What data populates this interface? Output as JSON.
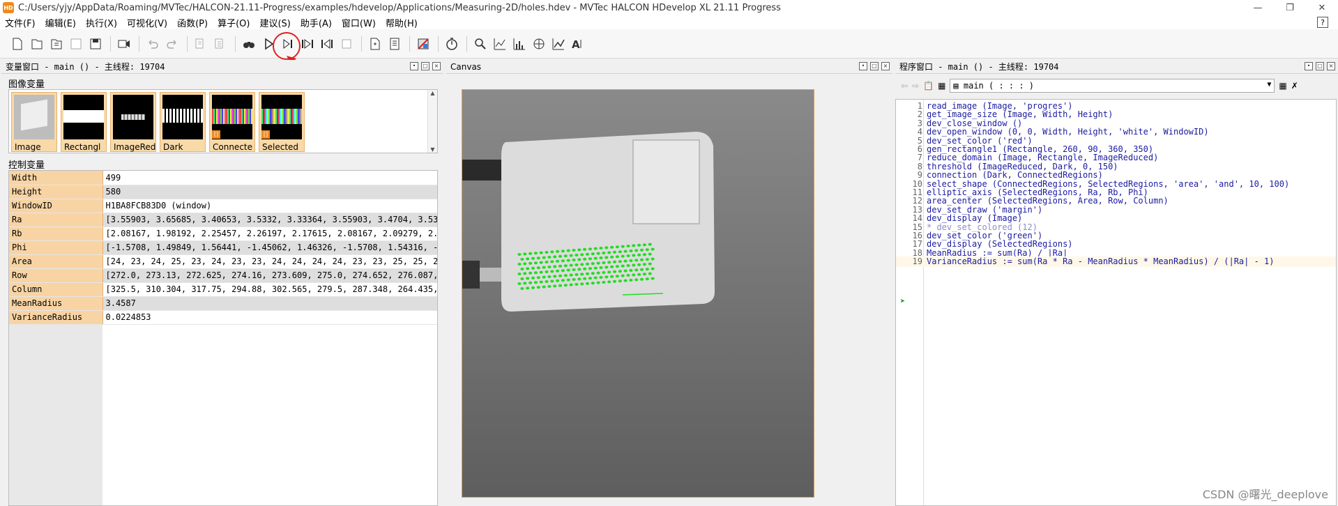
{
  "window": {
    "title": "C:/Users/yjy/AppData/Roaming/MVTec/HALCON-21.11-Progress/examples/hdevelop/Applications/Measuring-2D/holes.hdev - MVTec HALCON HDevelop XL 21.11 Progress",
    "app_icon": "HD"
  },
  "menu": [
    "文件(F)",
    "编辑(E)",
    "执行(X)",
    "可视化(V)",
    "函数(P)",
    "算子(O)",
    "建议(S)",
    "助手(A)",
    "窗口(W)",
    "帮助(H)"
  ],
  "variable_window": {
    "title": "变量窗口 - main () - 主线程: 19704",
    "iconic_label": "图像变量",
    "iconic": [
      "Image",
      "Rectangl",
      "ImageRed",
      "Dark",
      "Connecte",
      "Selected"
    ],
    "control_label": "控制变量",
    "control": [
      {
        "name": "Width",
        "value": "499"
      },
      {
        "name": "Height",
        "value": "580"
      },
      {
        "name": "WindowID",
        "value": "H1BA8FCB83D0 (window)"
      },
      {
        "name": "Ra",
        "value": "[3.55903, 3.65685, 3.40653, 3.5332, 3.33364, 3.55903, 3.4704, 3.53…"
      },
      {
        "name": "Rb",
        "value": "[2.08167, 1.98192, 2.25457, 2.26197, 2.17615, 2.08167, 2.09279, 2.…"
      },
      {
        "name": "Phi",
        "value": "[-1.5708, 1.49849, 1.56441, -1.45062, 1.46326, -1.5708, 1.54316, -…"
      },
      {
        "name": "Area",
        "value": "[24, 23, 24, 25, 23, 24, 23, 23, 24, 24, 24, 24, 23, 23, 25, 25, 2…"
      },
      {
        "name": "Row",
        "value": "[272.0, 273.13, 272.625, 274.16, 273.609, 275.0, 274.652, 276.087,…"
      },
      {
        "name": "Column",
        "value": "[325.5, 310.304, 317.75, 294.88, 302.565, 279.5, 287.348, 264.435,…"
      },
      {
        "name": "MeanRadius",
        "value": "3.4587"
      },
      {
        "name": "VarianceRadius",
        "value": "0.0224853"
      }
    ]
  },
  "canvas": {
    "title": "Canvas"
  },
  "program_window": {
    "title": "程序窗口 - main () - 主线程: 19704",
    "procedure": "main ( : : : )",
    "lines": [
      "read_image (Image, 'progres')",
      "get_image_size (Image, Width, Height)",
      "dev_close_window ()",
      "dev_open_window (0, 0, Width, Height, 'white', WindowID)",
      "dev_set_color ('red')",
      "gen_rectangle1 (Rectangle, 260, 90, 360, 350)",
      "reduce_domain (Image, Rectangle, ImageReduced)",
      "threshold (ImageReduced, Dark, 0, 150)",
      "connection (Dark, ConnectedRegions)",
      "select_shape (ConnectedRegions, SelectedRegions, 'area', 'and', 10, 100)",
      "elliptic_axis (SelectedRegions, Ra, Rb, Phi)",
      "area_center (SelectedRegions, Area, Row, Column)",
      "dev_set_draw ('margin')",
      "dev_display (Image)",
      "* dev_set_colored (12)",
      "dev_set_color ('green')",
      "dev_display (SelectedRegions)",
      "MeanRadius := sum(Ra) / |Ra|",
      "VarianceRadius := sum(Ra * Ra - MeanRadius * MeanRadius) / (|Ra| - 1)"
    ],
    "line_numbers": [
      "1",
      "2",
      "3",
      "4",
      "5",
      "6",
      "7",
      "8",
      "9",
      "10",
      "11",
      "12",
      "13",
      "14",
      "15",
      "16",
      "17",
      "18",
      "19"
    ]
  },
  "toolbar_icons": [
    "new-file-icon",
    "open-icon",
    "open-example-icon",
    "save-icon",
    "save-all-icon",
    "record-icon",
    "undo-icon",
    "redo-icon",
    "cut-icon",
    "paste-icon",
    "find-icon",
    "run-icon",
    "step-over-icon",
    "step-into-icon",
    "step-out-icon",
    "stop-icon",
    "insert-icon",
    "program-icon",
    "settings-icon",
    "timer-icon",
    "zoom-icon",
    "histogram-icon",
    "line-profile-icon",
    "gray-histogram-icon",
    "feature-icon",
    "font-icon"
  ],
  "watermark": "CSDN @曙光_deeplove",
  "colors": {
    "accent": "#f08a1c",
    "highlight": "#e02020",
    "var_name_bg": "#f8d4a4",
    "code_text": "#1a1aa0",
    "region_green": "#22dd22"
  }
}
